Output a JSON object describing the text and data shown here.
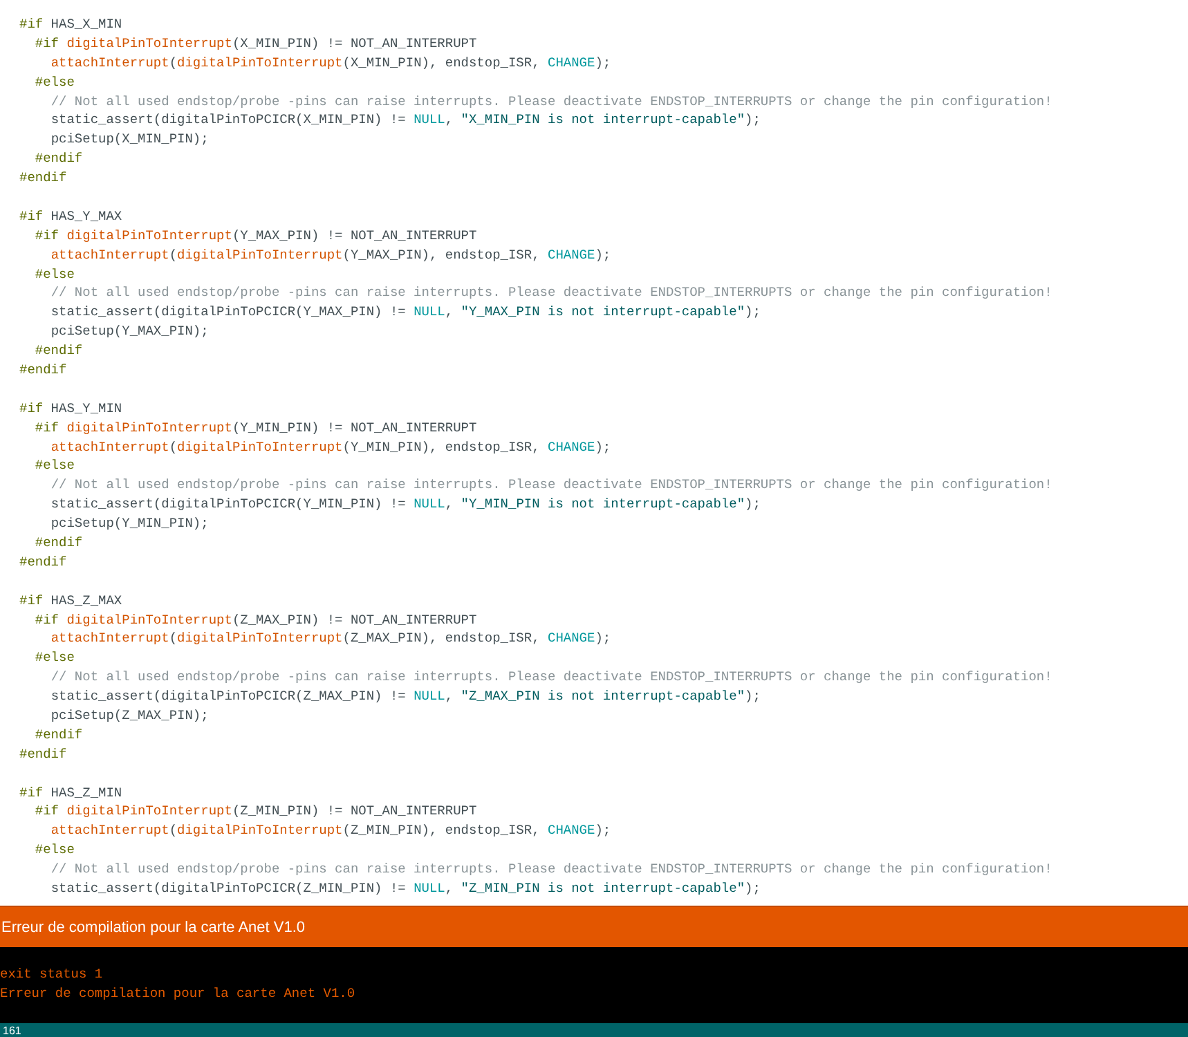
{
  "editor": {
    "lines": [
      {
        "kind": "code",
        "tokens": [
          {
            "kind": "directive",
            "text": "#if"
          },
          {
            "kind": "plain",
            "text": " HAS_X_MIN"
          }
        ]
      },
      {
        "kind": "code",
        "tokens": [
          {
            "kind": "directive",
            "text": "  #if"
          },
          {
            "kind": "function",
            "text": " digitalPinToInterrupt"
          },
          {
            "kind": "plain",
            "text": "(X_MIN_PIN) != NOT_AN_INTERRUPT"
          }
        ]
      },
      {
        "kind": "code",
        "tokens": [
          {
            "kind": "function",
            "text": "    attachInterrupt"
          },
          {
            "kind": "plain",
            "text": "("
          },
          {
            "kind": "function",
            "text": "digitalPinToInterrupt"
          },
          {
            "kind": "plain",
            "text": "(X_MIN_PIN), endstop_ISR, "
          },
          {
            "kind": "constant",
            "text": "CHANGE"
          },
          {
            "kind": "plain",
            "text": ");"
          }
        ]
      },
      {
        "kind": "code",
        "tokens": [
          {
            "kind": "directive",
            "text": "  #else"
          }
        ]
      },
      {
        "kind": "code",
        "tokens": [
          {
            "kind": "comment",
            "text": "    // Not all used endstop/probe -pins can raise interrupts. Please deactivate ENDSTOP_INTERRUPTS or change the pin configuration!"
          }
        ]
      },
      {
        "kind": "code",
        "tokens": [
          {
            "kind": "plain",
            "text": "    static_assert(digitalPinToPCICR(X_MIN_PIN) != "
          },
          {
            "kind": "constant",
            "text": "NULL"
          },
          {
            "kind": "plain",
            "text": ", "
          },
          {
            "kind": "string",
            "text": "\"X_MIN_PIN is not interrupt-capable\""
          },
          {
            "kind": "plain",
            "text": ");"
          }
        ]
      },
      {
        "kind": "code",
        "tokens": [
          {
            "kind": "plain",
            "text": "    pciSetup(X_MIN_PIN);"
          }
        ]
      },
      {
        "kind": "code",
        "tokens": [
          {
            "kind": "directive",
            "text": "  #endif"
          }
        ]
      },
      {
        "kind": "code",
        "tokens": [
          {
            "kind": "directive",
            "text": "#endif"
          }
        ]
      },
      {
        "kind": "blank"
      },
      {
        "kind": "code",
        "tokens": [
          {
            "kind": "directive",
            "text": "#if"
          },
          {
            "kind": "plain",
            "text": " HAS_Y_MAX"
          }
        ]
      },
      {
        "kind": "code",
        "tokens": [
          {
            "kind": "directive",
            "text": "  #if"
          },
          {
            "kind": "function",
            "text": " digitalPinToInterrupt"
          },
          {
            "kind": "plain",
            "text": "(Y_MAX_PIN) != NOT_AN_INTERRUPT"
          }
        ]
      },
      {
        "kind": "code",
        "tokens": [
          {
            "kind": "function",
            "text": "    attachInterrupt"
          },
          {
            "kind": "plain",
            "text": "("
          },
          {
            "kind": "function",
            "text": "digitalPinToInterrupt"
          },
          {
            "kind": "plain",
            "text": "(Y_MAX_PIN), endstop_ISR, "
          },
          {
            "kind": "constant",
            "text": "CHANGE"
          },
          {
            "kind": "plain",
            "text": ");"
          }
        ]
      },
      {
        "kind": "code",
        "tokens": [
          {
            "kind": "directive",
            "text": "  #else"
          }
        ]
      },
      {
        "kind": "code",
        "tokens": [
          {
            "kind": "comment",
            "text": "    // Not all used endstop/probe -pins can raise interrupts. Please deactivate ENDSTOP_INTERRUPTS or change the pin configuration!"
          }
        ]
      },
      {
        "kind": "code",
        "tokens": [
          {
            "kind": "plain",
            "text": "    static_assert(digitalPinToPCICR(Y_MAX_PIN) != "
          },
          {
            "kind": "constant",
            "text": "NULL"
          },
          {
            "kind": "plain",
            "text": ", "
          },
          {
            "kind": "string",
            "text": "\"Y_MAX_PIN is not interrupt-capable\""
          },
          {
            "kind": "plain",
            "text": ");"
          }
        ]
      },
      {
        "kind": "code",
        "tokens": [
          {
            "kind": "plain",
            "text": "    pciSetup(Y_MAX_PIN);"
          }
        ]
      },
      {
        "kind": "code",
        "tokens": [
          {
            "kind": "directive",
            "text": "  #endif"
          }
        ]
      },
      {
        "kind": "code",
        "tokens": [
          {
            "kind": "directive",
            "text": "#endif"
          }
        ]
      },
      {
        "kind": "blank"
      },
      {
        "kind": "code",
        "tokens": [
          {
            "kind": "directive",
            "text": "#if"
          },
          {
            "kind": "plain",
            "text": " HAS_Y_MIN"
          }
        ]
      },
      {
        "kind": "code",
        "tokens": [
          {
            "kind": "directive",
            "text": "  #if"
          },
          {
            "kind": "function",
            "text": " digitalPinToInterrupt"
          },
          {
            "kind": "plain",
            "text": "(Y_MIN_PIN) != NOT_AN_INTERRUPT"
          }
        ]
      },
      {
        "kind": "code",
        "tokens": [
          {
            "kind": "function",
            "text": "    attachInterrupt"
          },
          {
            "kind": "plain",
            "text": "("
          },
          {
            "kind": "function",
            "text": "digitalPinToInterrupt"
          },
          {
            "kind": "plain",
            "text": "(Y_MIN_PIN), endstop_ISR, "
          },
          {
            "kind": "constant",
            "text": "CHANGE"
          },
          {
            "kind": "plain",
            "text": ");"
          }
        ]
      },
      {
        "kind": "code",
        "tokens": [
          {
            "kind": "directive",
            "text": "  #else"
          }
        ]
      },
      {
        "kind": "code",
        "tokens": [
          {
            "kind": "comment",
            "text": "    // Not all used endstop/probe -pins can raise interrupts. Please deactivate ENDSTOP_INTERRUPTS or change the pin configuration!"
          }
        ]
      },
      {
        "kind": "code",
        "tokens": [
          {
            "kind": "plain",
            "text": "    static_assert(digitalPinToPCICR(Y_MIN_PIN) != "
          },
          {
            "kind": "constant",
            "text": "NULL"
          },
          {
            "kind": "plain",
            "text": ", "
          },
          {
            "kind": "string",
            "text": "\"Y_MIN_PIN is not interrupt-capable\""
          },
          {
            "kind": "plain",
            "text": ");"
          }
        ]
      },
      {
        "kind": "code",
        "tokens": [
          {
            "kind": "plain",
            "text": "    pciSetup(Y_MIN_PIN);"
          }
        ]
      },
      {
        "kind": "code",
        "tokens": [
          {
            "kind": "directive",
            "text": "  #endif"
          }
        ]
      },
      {
        "kind": "code",
        "tokens": [
          {
            "kind": "directive",
            "text": "#endif"
          }
        ]
      },
      {
        "kind": "blank"
      },
      {
        "kind": "code",
        "tokens": [
          {
            "kind": "directive",
            "text": "#if"
          },
          {
            "kind": "plain",
            "text": " HAS_Z_MAX"
          }
        ]
      },
      {
        "kind": "code",
        "tokens": [
          {
            "kind": "directive",
            "text": "  #if"
          },
          {
            "kind": "function",
            "text": " digitalPinToInterrupt"
          },
          {
            "kind": "plain",
            "text": "(Z_MAX_PIN) != NOT_AN_INTERRUPT"
          }
        ]
      },
      {
        "kind": "code",
        "tokens": [
          {
            "kind": "function",
            "text": "    attachInterrupt"
          },
          {
            "kind": "plain",
            "text": "("
          },
          {
            "kind": "function",
            "text": "digitalPinToInterrupt"
          },
          {
            "kind": "plain",
            "text": "(Z_MAX_PIN), endstop_ISR, "
          },
          {
            "kind": "constant",
            "text": "CHANGE"
          },
          {
            "kind": "plain",
            "text": ");"
          }
        ]
      },
      {
        "kind": "code",
        "tokens": [
          {
            "kind": "directive",
            "text": "  #else"
          }
        ]
      },
      {
        "kind": "code",
        "tokens": [
          {
            "kind": "comment",
            "text": "    // Not all used endstop/probe -pins can raise interrupts. Please deactivate ENDSTOP_INTERRUPTS or change the pin configuration!"
          }
        ]
      },
      {
        "kind": "code",
        "tokens": [
          {
            "kind": "plain",
            "text": "    static_assert(digitalPinToPCICR(Z_MAX_PIN) != "
          },
          {
            "kind": "constant",
            "text": "NULL"
          },
          {
            "kind": "plain",
            "text": ", "
          },
          {
            "kind": "string",
            "text": "\"Z_MAX_PIN is not interrupt-capable\""
          },
          {
            "kind": "plain",
            "text": ");"
          }
        ]
      },
      {
        "kind": "code",
        "tokens": [
          {
            "kind": "plain",
            "text": "    pciSetup(Z_MAX_PIN);"
          }
        ]
      },
      {
        "kind": "code",
        "tokens": [
          {
            "kind": "directive",
            "text": "  #endif"
          }
        ]
      },
      {
        "kind": "code",
        "tokens": [
          {
            "kind": "directive",
            "text": "#endif"
          }
        ]
      },
      {
        "kind": "blank"
      },
      {
        "kind": "code",
        "tokens": [
          {
            "kind": "directive",
            "text": "#if"
          },
          {
            "kind": "plain",
            "text": " HAS_Z_MIN"
          }
        ]
      },
      {
        "kind": "code",
        "tokens": [
          {
            "kind": "directive",
            "text": "  #if"
          },
          {
            "kind": "function",
            "text": " digitalPinToInterrupt"
          },
          {
            "kind": "plain",
            "text": "(Z_MIN_PIN) != NOT_AN_INTERRUPT"
          }
        ]
      },
      {
        "kind": "code",
        "tokens": [
          {
            "kind": "function",
            "text": "    attachInterrupt"
          },
          {
            "kind": "plain",
            "text": "("
          },
          {
            "kind": "function",
            "text": "digitalPinToInterrupt"
          },
          {
            "kind": "plain",
            "text": "(Z_MIN_PIN), endstop_ISR, "
          },
          {
            "kind": "constant",
            "text": "CHANGE"
          },
          {
            "kind": "plain",
            "text": ");"
          }
        ]
      },
      {
        "kind": "code",
        "tokens": [
          {
            "kind": "directive",
            "text": "  #else"
          }
        ]
      },
      {
        "kind": "code",
        "tokens": [
          {
            "kind": "comment",
            "text": "    // Not all used endstop/probe -pins can raise interrupts. Please deactivate ENDSTOP_INTERRUPTS or change the pin configuration!"
          }
        ]
      },
      {
        "kind": "code",
        "tokens": [
          {
            "kind": "plain",
            "text": "    static_assert(digitalPinToPCICR(Z_MIN_PIN) != "
          },
          {
            "kind": "constant",
            "text": "NULL"
          },
          {
            "kind": "plain",
            "text": ", "
          },
          {
            "kind": "string",
            "text": "\"Z_MIN_PIN is not interrupt-capable\""
          },
          {
            "kind": "plain",
            "text": ");"
          }
        ]
      }
    ]
  },
  "error_bar": {
    "message": "Erreur de compilation pour la carte Anet V1.0"
  },
  "console": {
    "lines": [
      "exit status 1",
      "Erreur de compilation pour la carte Anet V1.0"
    ]
  },
  "status_bar": {
    "line_number": "161"
  }
}
